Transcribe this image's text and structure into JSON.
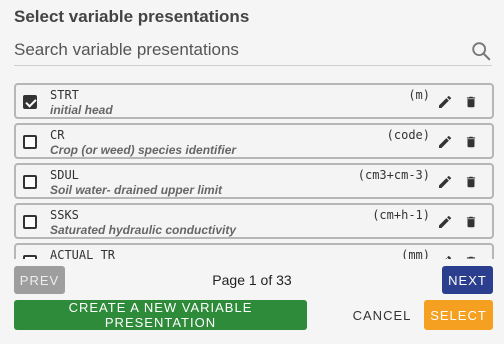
{
  "dialog": {
    "title": "Select variable presentations"
  },
  "search": {
    "placeholder": "Search variable presentations",
    "value": ""
  },
  "variables": [
    {
      "code": "STRT",
      "description": "initial head",
      "unit": "(m)",
      "checked": true
    },
    {
      "code": "CR",
      "description": "Crop (or weed) species identifier",
      "unit": "(code)",
      "checked": false
    },
    {
      "code": "SDUL",
      "description": "Soil water- drained upper limit",
      "unit": "(cm3+cm-3)",
      "checked": false
    },
    {
      "code": "SSKS",
      "description": "Saturated hydraulic conductivity",
      "unit": "(cm+h-1)",
      "checked": false
    },
    {
      "code": "ACTUAL TR",
      "description": "",
      "unit": "(mm)",
      "checked": false
    }
  ],
  "pagination": {
    "prev_label": "PREV",
    "next_label": "NEXT",
    "page_text": "Page 1 of 33"
  },
  "actions": {
    "create_label": "CREATE A NEW VARIABLE PRESENTATION",
    "cancel_label": "CANCEL",
    "select_label": "SELECT"
  },
  "icons": {
    "search": "search-icon",
    "edit": "pencil-icon",
    "delete": "trash-icon",
    "checkbox": "checkbox-icon"
  },
  "colors": {
    "prev": "#9e9e9e",
    "next": "#2c3f8f",
    "create": "#2e8b3a",
    "select": "#f5a020"
  }
}
